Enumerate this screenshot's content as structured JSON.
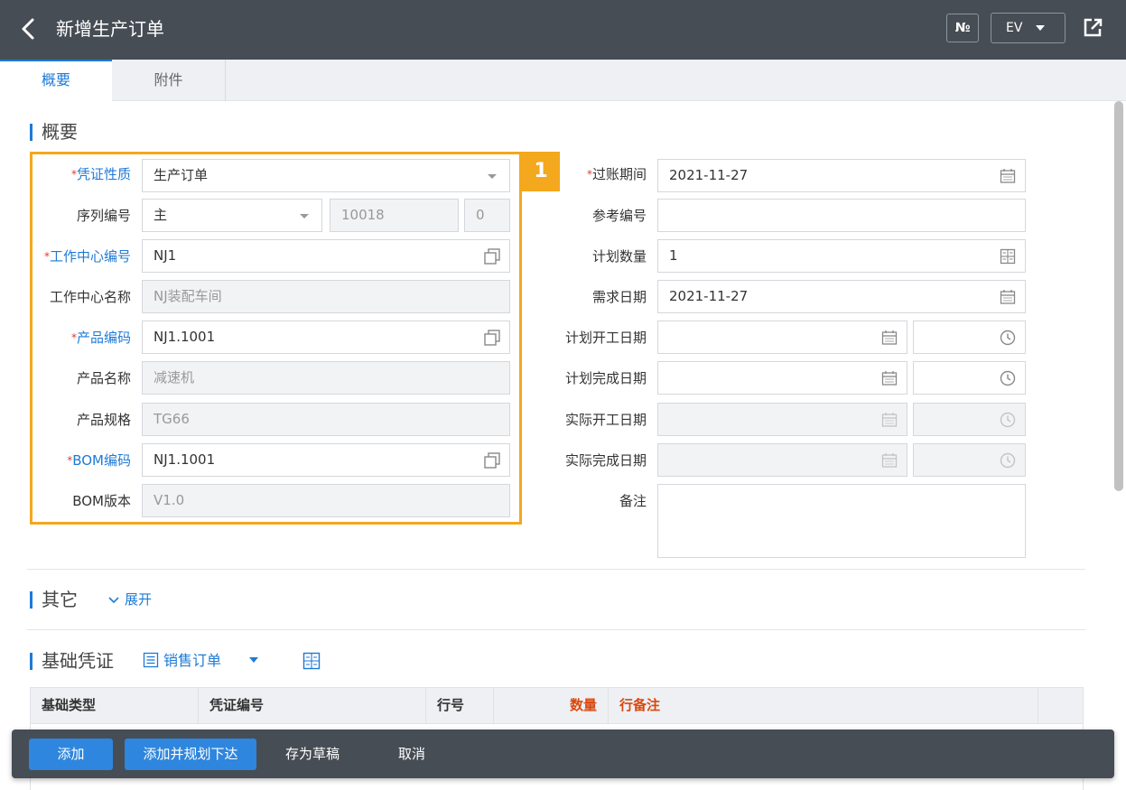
{
  "header": {
    "title": "新增生产订单",
    "no_label": "№",
    "lang_label": "EV"
  },
  "tabs": [
    {
      "label": "概要",
      "active": true
    },
    {
      "label": "附件",
      "active": false
    }
  ],
  "sections": {
    "summary": "概要",
    "other": "其它",
    "expand": "展开",
    "base": "基础凭证"
  },
  "left_form": {
    "voucher_type": {
      "label": "凭证性质",
      "value": "生产订单"
    },
    "serial_no": {
      "label": "序列编号",
      "value": "主",
      "number": "10018",
      "suffix": "0"
    },
    "workcenter_code": {
      "label": "工作中心编号",
      "value": "NJ1"
    },
    "workcenter_name": {
      "label": "工作中心名称",
      "value": "NJ装配车间"
    },
    "product_code": {
      "label": "产品编码",
      "value": "NJ1.1001"
    },
    "product_name": {
      "label": "产品名称",
      "value": "减速机"
    },
    "product_spec": {
      "label": "产品规格",
      "value": "TG66"
    },
    "bom_code": {
      "label": "BOM编码",
      "value": "NJ1.1001"
    },
    "bom_version": {
      "label": "BOM版本",
      "value": "V1.0"
    }
  },
  "highlight_number": "1",
  "right_form": {
    "posting_period": {
      "label": "过账期间",
      "value": "2021-11-27"
    },
    "ref_no": {
      "label": "参考编号",
      "value": ""
    },
    "plan_qty": {
      "label": "计划数量",
      "value": "1"
    },
    "demand_date": {
      "label": "需求日期",
      "value": "2021-11-27"
    },
    "plan_start": {
      "label": "计划开工日期"
    },
    "plan_finish": {
      "label": "计划完成日期"
    },
    "actual_start": {
      "label": "实际开工日期"
    },
    "actual_finish": {
      "label": "实际完成日期"
    },
    "remark": {
      "label": "备注"
    }
  },
  "base_voucher": {
    "sales_order_label": "销售订单"
  },
  "table": {
    "columns": [
      "基础类型",
      "凭证编号",
      "行号",
      "数量",
      "行备注"
    ]
  },
  "actions": {
    "add": "添加",
    "add_plan": "添加并规划下达",
    "save_draft": "存为草稿",
    "cancel": "取消"
  },
  "colors": {
    "header_bg": "#474d55",
    "accent": "#1e7ad6",
    "highlight": "#f4a81d",
    "required_star": "#e03c31",
    "table_red": "#d9480f"
  }
}
